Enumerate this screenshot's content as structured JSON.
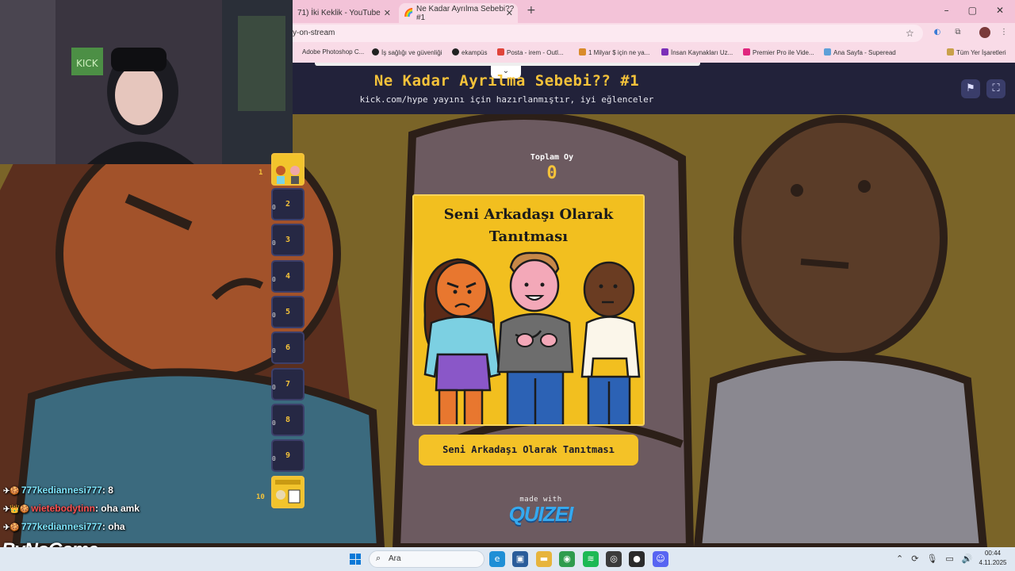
{
  "browser": {
    "tabs": [
      {
        "label": "71) İki Keklik - YouTube"
      },
      {
        "label": "Ne Kadar Ayrılma Sebebi?? #1"
      }
    ],
    "new_tab": "+",
    "window_controls": [
      "–",
      "▢",
      "✕"
    ],
    "address": "y-on-stream",
    "bookmarks": [
      {
        "label": "Adobe Photoshop C...",
        "color": "#1c3d7a"
      },
      {
        "label": "İş sağlığı ve güvenliği",
        "color": "#222222"
      },
      {
        "label": "ekampüs",
        "color": "#222222"
      },
      {
        "label": "Posta - irem - Outl...",
        "color": "#e0443a"
      },
      {
        "label": "1 Milyar $ için ne ya...",
        "color": "#d98b2b"
      },
      {
        "label": "İnsan Kaynakları Uz...",
        "color": "#7b2fb8"
      },
      {
        "label": "Premier Pro ile Vide...",
        "color": "#e0267e"
      },
      {
        "label": "Ana Sayfa - Superead",
        "color": "#5ea0d8"
      },
      {
        "label": "Tüm Yer İşaretleri",
        "color": "#f3c3d8"
      }
    ]
  },
  "quiz": {
    "title": "Ne Kadar Ayrılma Sebebi?? #1",
    "subtitle": "kick.com/hype yayını için hazırlanmıştır, iyi eğlenceler",
    "vote_label": "Toplam Oy",
    "vote_count": "0",
    "card_title_line1": "Seni Arkadaşı Olarak",
    "card_title_line2": "Tanıtması",
    "answer_button": "Seni Arkadaşı Olarak Tanıtması",
    "made_with": "made with",
    "brand": "QUIZEI",
    "bracket": {
      "first_number": "1",
      "slots": [
        "2",
        "3",
        "4",
        "5",
        "6",
        "7",
        "8",
        "9"
      ],
      "slot_votes": "0",
      "last_number": "10"
    }
  },
  "chat": [
    {
      "user": "777kediannesi777",
      "message": "8",
      "user_color": "#7fe7ff"
    },
    {
      "user": "wietebodytinn",
      "message": "oha amk",
      "user_color": "#ff5151"
    },
    {
      "user": "777kediannesi777",
      "message": "oha",
      "user_color": "#7fe7ff"
    }
  ],
  "stream_brand": "ByNoGame",
  "taskbar": {
    "search_placeholder": "Ara",
    "time": "00:44",
    "date": "4.11.2025"
  }
}
